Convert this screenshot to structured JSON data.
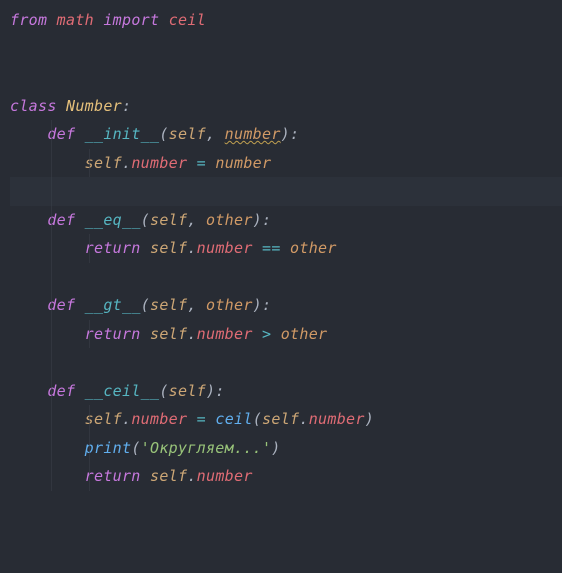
{
  "l1": {
    "from": "from",
    "math": "math",
    "import": "import",
    "ceil": "ceil"
  },
  "l4": {
    "class": "class",
    "Number": "Number"
  },
  "l5": {
    "def": "def",
    "name": "__init__",
    "self": "self",
    "p1": "number"
  },
  "l6": {
    "self": "self",
    "attr": "number",
    "eq": "=",
    "rhs": "number"
  },
  "l8": {
    "def": "def",
    "name": "__eq__",
    "self": "self",
    "p1": "other"
  },
  "l9": {
    "return": "return",
    "self": "self",
    "attr": "number",
    "op": "==",
    "rhs": "other"
  },
  "l11": {
    "def": "def",
    "name": "__gt__",
    "self": "self",
    "p1": "other"
  },
  "l12": {
    "return": "return",
    "self": "self",
    "attr": "number",
    "op": ">",
    "rhs": "other"
  },
  "l14": {
    "def": "def",
    "name": "__ceil__",
    "self": "self"
  },
  "l15": {
    "self": "self",
    "attr": "number",
    "eq": "=",
    "fn": "ceil",
    "self2": "self",
    "attr2": "number"
  },
  "l16": {
    "print": "print",
    "str": "'Округляем...'"
  },
  "l17": {
    "return": "return",
    "self": "self",
    "attr": "number"
  }
}
